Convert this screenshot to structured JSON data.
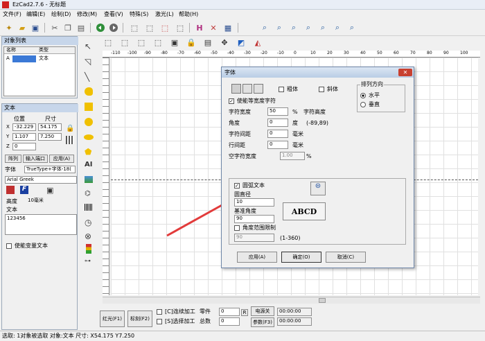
{
  "window": {
    "title": "EzCad2.7.6 - 无标题"
  },
  "menu": [
    "文件(F)",
    "编辑(E)",
    "绘制(D)",
    "修改(M)",
    "查看(V)",
    "特殊(S)",
    "激光(L)",
    "帮助(H)"
  ],
  "object_list": {
    "header": "对象列表",
    "col_name": "名称",
    "col_type": "类型",
    "row_name": "A",
    "row_type": "文本"
  },
  "text_panel": {
    "header": "文本",
    "pos_label": "位置",
    "size_label": "尺寸",
    "x_label": "X",
    "y_label": "Y",
    "z_label": "Z",
    "x_pos": "-32.229",
    "y_pos": "1.107",
    "z_pos": "0",
    "width": "54.175",
    "height": "7.250",
    "array_btn": "阵列",
    "input_port_btn": "输入端口",
    "apply_btn": "应用(A)",
    "font_label": "字体",
    "font_value": "TrueType+字体-18(",
    "font_name": "Arial Greek",
    "height_label": "高度",
    "height_value": "10毫米",
    "text_label": "文本",
    "text_value": "123456",
    "var_text_label": "使能变量文本"
  },
  "ruler_labels": [
    "-110",
    "-100",
    "-90",
    "-80",
    "-70",
    "-60",
    "-50",
    "-40",
    "-30",
    "-20",
    "-10",
    "0",
    "10",
    "20",
    "30",
    "40",
    "50",
    "60",
    "70",
    "80",
    "90",
    "100",
    "110"
  ],
  "dialog": {
    "title": "字体",
    "bold": "粗体",
    "italic": "斜体",
    "direction_group": "排列方向",
    "horizontal": "水平",
    "vertical": "垂直",
    "equal_width": "使能等宽度字符",
    "char_width_label": "字符宽度",
    "char_width": "50",
    "char_width_unit": "%",
    "char_height_label": "字符高度",
    "angle_label": "角度",
    "angle": "0",
    "angle_unit": "度",
    "angle_range": "(-89,89)",
    "char_spacing_label": "字符间距",
    "char_spacing": "0",
    "char_spacing_unit": "毫米",
    "line_spacing_label": "行间距",
    "line_spacing": "0",
    "line_spacing_unit": "毫米",
    "space_width_label": "空字符宽度",
    "space_width": "1.00",
    "space_width_unit": "%",
    "arc_text": "圆弧文本",
    "arc_diameter_label": "圆直径",
    "arc_diameter": "10",
    "base_angle_label": "基准角度",
    "base_angle": "90",
    "abcd_preview": "ABCD",
    "angle_limit": "角度范围限制",
    "angle_limit_value": "90",
    "angle_limit_range": "(1-360)",
    "apply": "应用(A)",
    "ok": "确定(O)",
    "cancel": "取消(C)"
  },
  "bottom": {
    "red_light": "红光(F1)",
    "mark": "标刻(F2)",
    "continuous": "[C]连续加工",
    "select_mark": "[S]选择加工",
    "parts_label": "零件",
    "parts_value": "0",
    "total_label": "总数",
    "total_value": "0",
    "r_btn": "R",
    "power_btn": "电源关",
    "params_btn": "参数(F3)",
    "time1": "00:00:00",
    "time2": "00:00:00"
  },
  "status": "选取: 1对象被选取 对象:文本 尺寸: X54.175 Y7.250",
  "colors": {
    "arrow": "#e23b3b",
    "accent_blue": "#3b79d6",
    "title_bg": "#c7d6ea"
  }
}
